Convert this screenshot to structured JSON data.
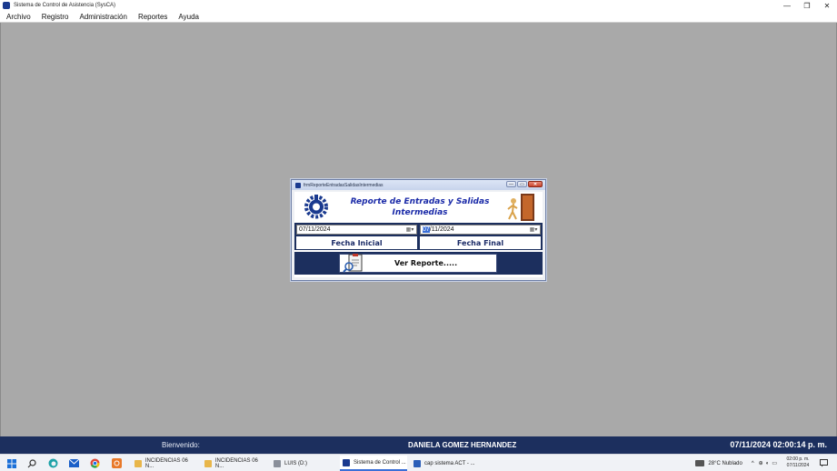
{
  "window": {
    "title": "Sistema de Control de Asistencia (SysCA)",
    "minimize": "—",
    "maximize": "❐",
    "close": "✕"
  },
  "menu": [
    "Archivo",
    "Registro",
    "Administración",
    "Reportes",
    "Ayuda"
  ],
  "dialog": {
    "title": "frmReporteEntradasSalidasIntermedias",
    "report_title_line1": "Reporte de Entradas y Salidas",
    "report_title_line2": "Intermedias",
    "start_date_value": "07/11/2024",
    "end_date_selected": "07",
    "end_date_rest": "/11/2024",
    "start_label": "Fecha Inicial",
    "end_label": "Fecha Final",
    "report_button": "Ver Reporte.....",
    "calendar_glyph": "▦▾"
  },
  "status": {
    "welcome": "Bienvenido:",
    "user": "DANIELA GOMEZ HERNANDEZ",
    "datetime": "07/11/2024 02:00:14 p. m."
  },
  "taskbar": {
    "apps": [
      {
        "label": "INCIDENCIAS 06 N...",
        "color": "#e8b64a"
      },
      {
        "label": "INCIDENCIAS 06 N...",
        "color": "#e8b64a"
      },
      {
        "label": "LUIS (D:)",
        "color": "#8a8f9a"
      },
      {
        "label": "Sistema de Control ...",
        "color": "#1a3a8f"
      },
      {
        "label": "cap sistema ACT - ...",
        "color": "#2b5eb8"
      }
    ],
    "weather": "28°C  Nublado",
    "clock_time": "02:00 p. m.",
    "clock_date": "07/11/2024"
  },
  "colors": {
    "mdi_background": "#a9a9a9",
    "status_background": "#1c2f5e",
    "title_text": "#1a2aa8"
  }
}
